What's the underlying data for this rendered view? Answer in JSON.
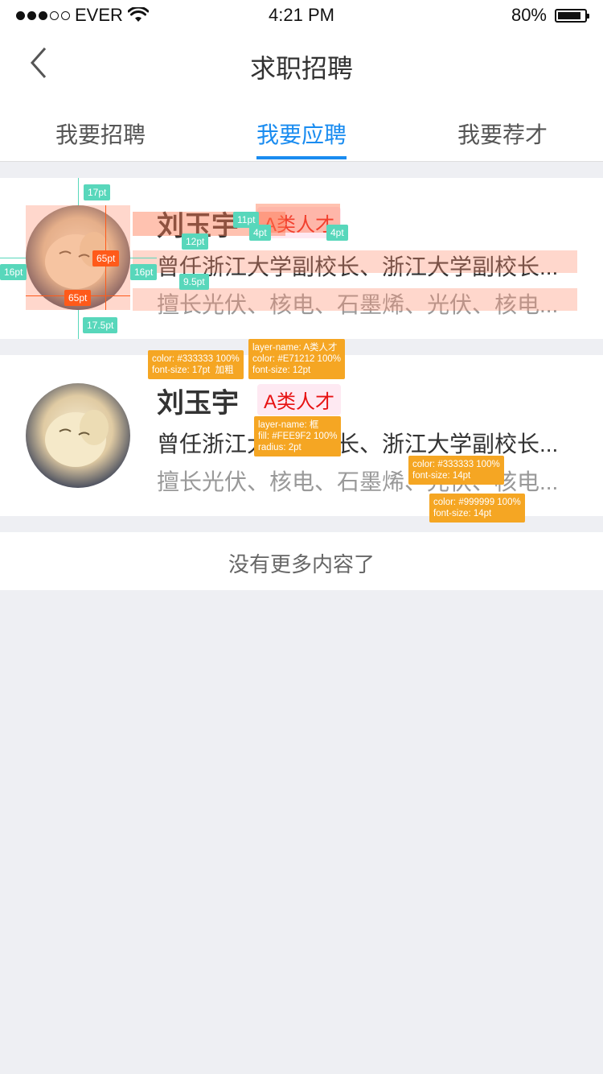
{
  "status_bar": {
    "carrier": "EVER",
    "time": "4:21 PM",
    "battery": "80%"
  },
  "nav": {
    "title": "求职招聘",
    "back_icon": "chevron-left-icon"
  },
  "tabs": [
    {
      "label": "我要招聘"
    },
    {
      "label": "我要应聘"
    },
    {
      "label": "我要荐才"
    }
  ],
  "cards": [
    {
      "name": "刘玉宇",
      "tag": "A类人才",
      "line1": "曾任浙江大学副校长、浙江大学副校长...",
      "line2": "擅长光伏、核电、石墨烯、光伏、核电..."
    },
    {
      "name": "刘玉宇",
      "tag": "A类人才",
      "line1": "曾任浙江大学副校长、浙江大学副校长...",
      "line2": "擅长光伏、核电、石墨烯、光伏、核电..."
    }
  ],
  "footer": "没有更多内容了",
  "annotations": {
    "m_17pt": "17pt",
    "m_11pt": "11pt",
    "m_4pt_a": "4pt",
    "m_4pt_b": "4pt",
    "m_12pt": "12pt",
    "m_65pt_v": "65pt",
    "m_16pt_l": "16pt",
    "m_16pt_r": "16pt",
    "m_9_5pt": "9.5pt",
    "m_65pt_h": "65pt",
    "m_17_5pt": "17.5pt",
    "tip_name": "color: #333333 100%\nfont-size: 17pt  加粗",
    "tip_tag_text": "layer-name: A类人才\ncolor: #E71212 100%\nfont-size: 12pt",
    "tip_tag_box": "layer-name: 框\nfill: #FEE9F2 100%\nradius: 2pt",
    "tip_line1": "color: #333333 100%\nfont-size: 14pt",
    "tip_line2": "color: #999999 100%\nfont-size: 14pt"
  },
  "colors": {
    "accent": "#1a8cf0",
    "tag_text": "#E71212",
    "tag_bg": "#FEE9F2",
    "annotation_measure": "#58d7bb",
    "annotation_tip": "#f5a623"
  }
}
